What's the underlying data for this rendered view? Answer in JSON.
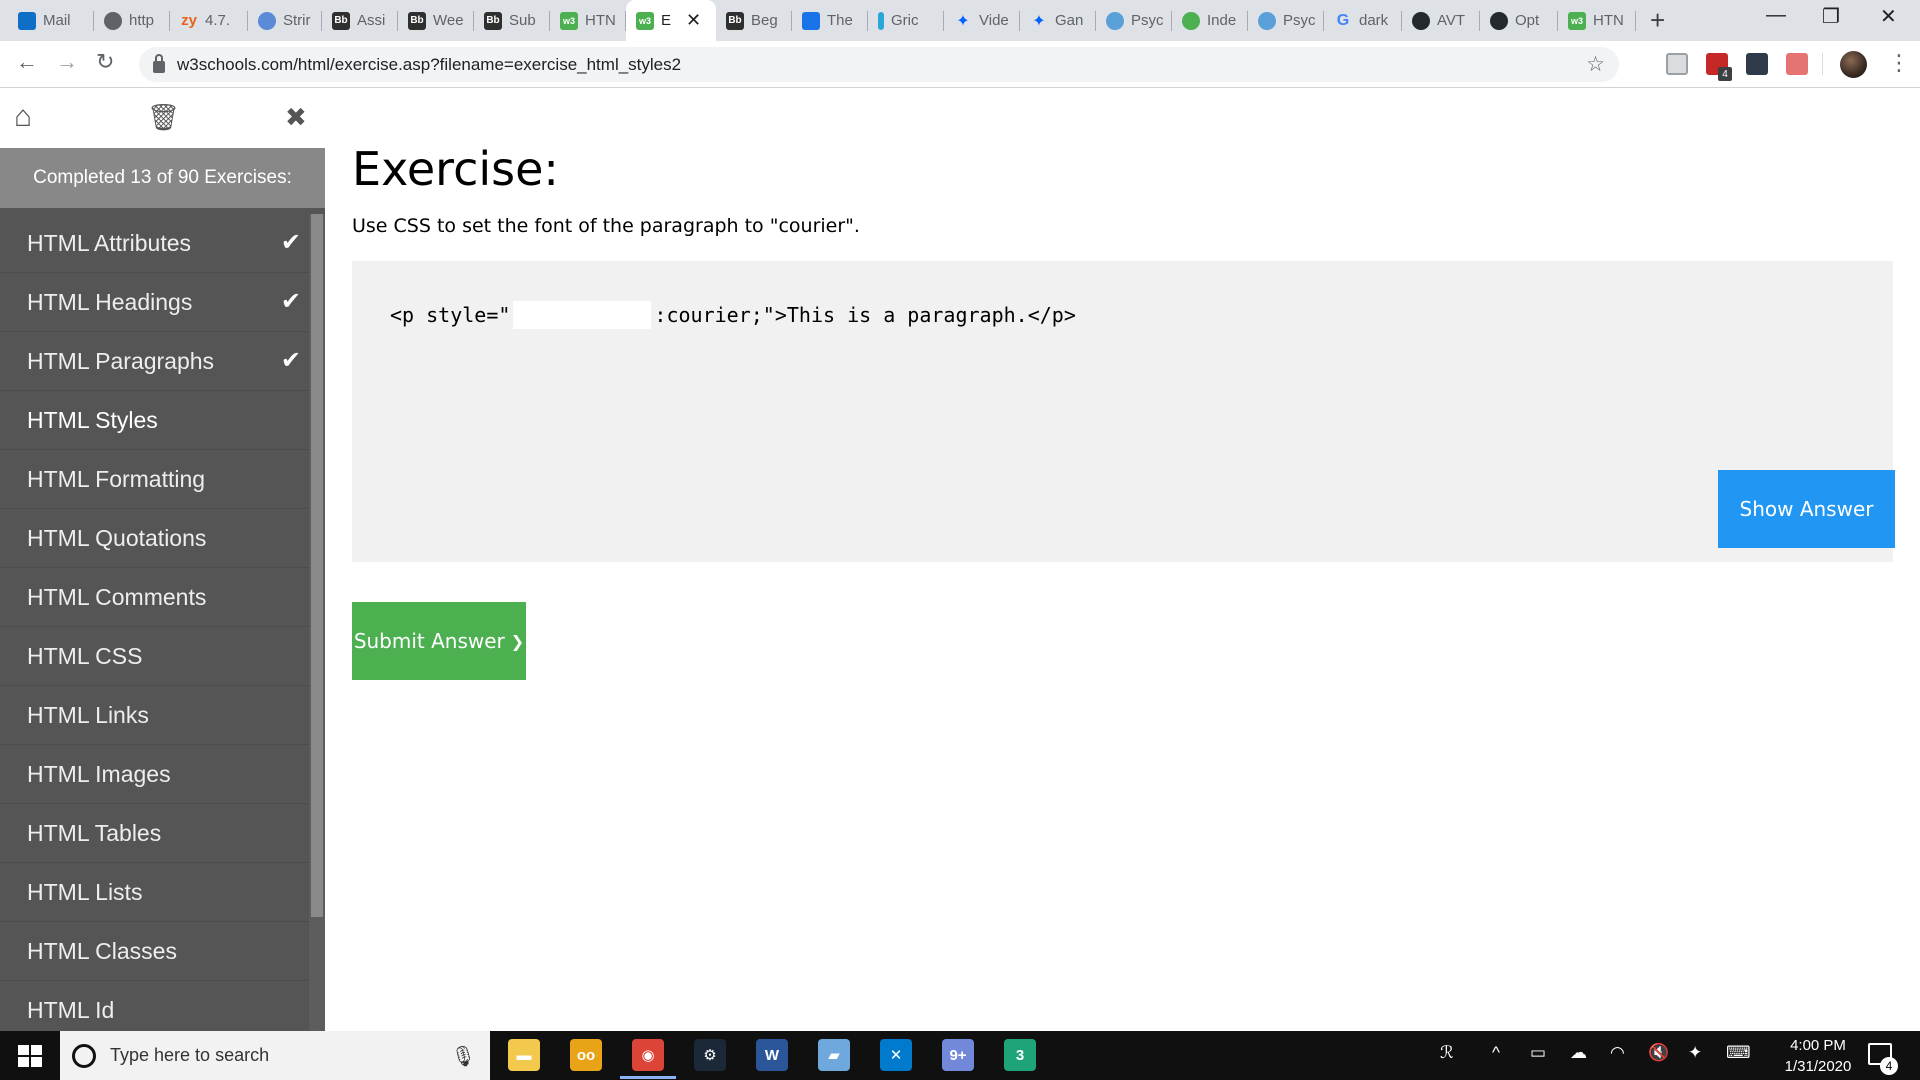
{
  "browser": {
    "tabs": [
      {
        "label": "Mail",
        "icon": "outlook-icon"
      },
      {
        "label": "http",
        "icon": "globe-icon"
      },
      {
        "label": "4.7.",
        "icon": "zybooks-icon",
        "icon_text": "zy"
      },
      {
        "label": "Strir",
        "icon": "web-icon"
      },
      {
        "label": "Assi",
        "icon": "blackboard-icon",
        "icon_text": "Bb"
      },
      {
        "label": "Wee",
        "icon": "blackboard-icon",
        "icon_text": "Bb"
      },
      {
        "label": "Sub",
        "icon": "blackboard-icon",
        "icon_text": "Bb"
      },
      {
        "label": "HTN",
        "icon": "w3schools-icon",
        "icon_text": "w3"
      },
      {
        "label": "E",
        "icon": "w3schools-icon",
        "icon_text": "w3",
        "active": true
      },
      {
        "label": "Beg",
        "icon": "blackboard-icon",
        "icon_text": "Bb"
      },
      {
        "label": "The",
        "icon": "prime-video-icon"
      },
      {
        "label": "Gric",
        "icon": "grid-icon"
      },
      {
        "label": "Vide",
        "icon": "dropbox-icon"
      },
      {
        "label": "Gan",
        "icon": "dropbox-icon"
      },
      {
        "label": "Psyc",
        "icon": "psych-icon"
      },
      {
        "label": "Inde",
        "icon": "leaf-icon"
      },
      {
        "label": "Psyc",
        "icon": "psych-icon"
      },
      {
        "label": "dark",
        "icon": "google-icon",
        "icon_text": "G"
      },
      {
        "label": "AVT",
        "icon": "github-icon"
      },
      {
        "label": "Opt",
        "icon": "github-icon"
      },
      {
        "label": "HTN",
        "icon": "w3schools-icon",
        "icon_text": "w3"
      }
    ],
    "new_tab_symbol": "+",
    "close_tab_symbol": "✕",
    "window_controls": {
      "minimize": "—",
      "maximize": "❐",
      "close": "✕"
    },
    "address": "w3schools.com/html/exercise.asp?filename=exercise_html_styles2",
    "extension_badge": "4",
    "nav": {
      "back": "←",
      "forward": "→",
      "reload": "↻",
      "star": "☆",
      "menu": "⋮"
    }
  },
  "sidebar": {
    "home_icon": "⌂",
    "trash_icon": "🗑",
    "close_icon": "✖",
    "progress_text": "Completed 13 of 90 Exercises:",
    "items": [
      {
        "label": "HTML Attributes",
        "completed": true
      },
      {
        "label": "HTML Headings",
        "completed": true
      },
      {
        "label": "HTML Paragraphs",
        "completed": true
      },
      {
        "label": "HTML Styles",
        "completed": false,
        "current": true
      },
      {
        "label": "HTML Formatting",
        "completed": false
      },
      {
        "label": "HTML Quotations",
        "completed": false
      },
      {
        "label": "HTML Comments",
        "completed": false
      },
      {
        "label": "HTML CSS",
        "completed": false
      },
      {
        "label": "HTML Links",
        "completed": false
      },
      {
        "label": "HTML Images",
        "completed": false
      },
      {
        "label": "HTML Tables",
        "completed": false
      },
      {
        "label": "HTML Lists",
        "completed": false
      },
      {
        "label": "HTML Classes",
        "completed": false
      },
      {
        "label": "HTML Id",
        "completed": false
      }
    ],
    "check_symbol": "✔"
  },
  "exercise": {
    "title": "Exercise:",
    "instruction": "Use CSS to set the font of the paragraph to \"courier\".",
    "code_before": "<p style=\"",
    "code_input_value": "",
    "code_after": ":courier;\">This is a paragraph.</p>",
    "show_answer_label": "Show Answer",
    "submit_label": "Submit Answer",
    "submit_chevron": "❯"
  },
  "taskbar": {
    "search_placeholder": "Type here to search",
    "mic_icon": "🎙",
    "apps": [
      {
        "name": "file-explorer-icon",
        "color": "#f2c94c",
        "text": "▬"
      },
      {
        "name": "ooo-icon",
        "color": "#e8a317",
        "text": "oo"
      },
      {
        "name": "chrome-icon",
        "color": "#db4437",
        "text": "◉",
        "active": true
      },
      {
        "name": "steam-icon",
        "color": "#1b2838",
        "text": "⚙"
      },
      {
        "name": "word-icon",
        "color": "#2b579a",
        "text": "W"
      },
      {
        "name": "notepad-icon",
        "color": "#6fa8dc",
        "text": "▰"
      },
      {
        "name": "vscode-icon",
        "color": "#007acc",
        "text": "✕"
      },
      {
        "name": "discord-icon",
        "color": "#7289da",
        "text": "9+"
      },
      {
        "name": "codeblocks-icon",
        "color": "#1fa37a",
        "text": "3"
      }
    ],
    "tray": {
      "people": "ℛ",
      "chevron": "^",
      "battery": "▭",
      "cloud": "☁",
      "wifi": "◠",
      "volume": "🔇",
      "dropbox": "✦",
      "keyboard": "⌨"
    },
    "time": "4:00 PM",
    "date": "1/31/2020",
    "notification_count": "4"
  }
}
